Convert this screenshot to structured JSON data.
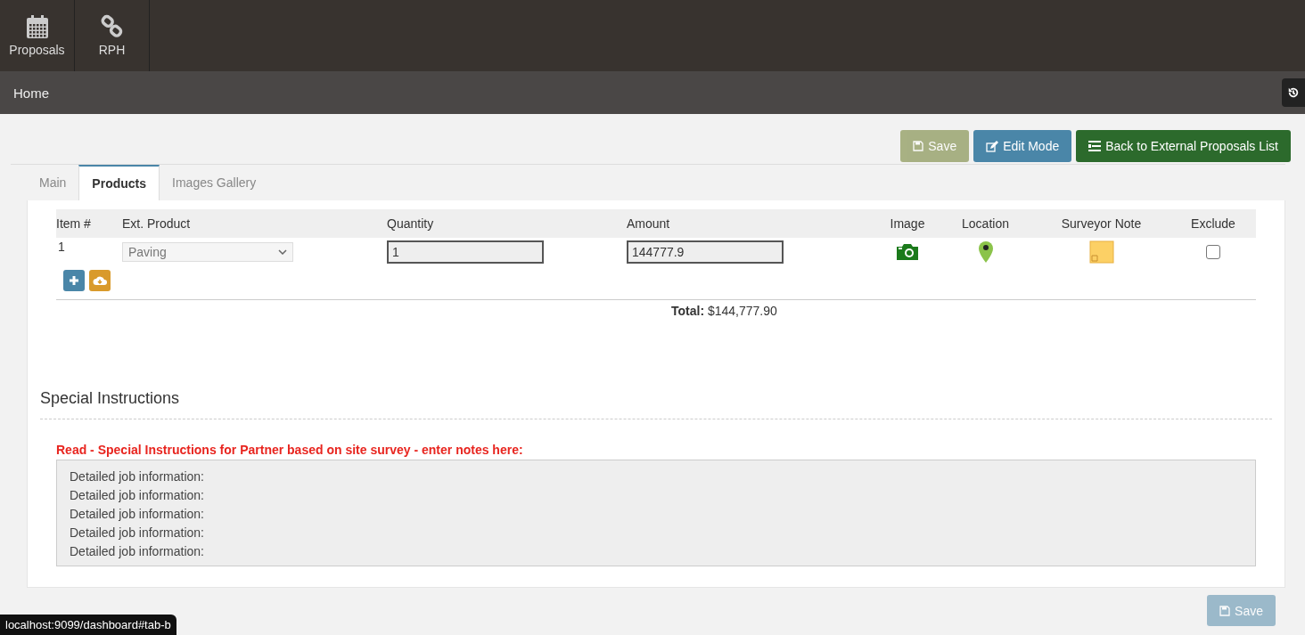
{
  "nav": [
    {
      "label": "Proposals",
      "kind": "calendar"
    },
    {
      "label": "RPH",
      "kind": "link"
    }
  ],
  "breadcrumb": "Home",
  "toolbar": [
    {
      "label": "Save",
      "kind": "save",
      "disabled": true
    },
    {
      "label": "Edit Mode",
      "kind": "edit",
      "disabled": false
    },
    {
      "label": "Back to External Proposals List",
      "kind": "list",
      "disabled": false
    }
  ],
  "tabs": [
    {
      "label": "Main",
      "selected": false
    },
    {
      "label": "Products",
      "selected": true
    },
    {
      "label": "Images Gallery",
      "selected": false
    }
  ],
  "table": {
    "columns": [
      "Item #",
      "Ext. Product",
      "Quantity",
      "Amount",
      "Image",
      "Location",
      "Surveyor Note",
      "Exclude"
    ],
    "rows": [
      {
        "item": "1",
        "product": "Paving",
        "quantity": "1",
        "amount": "144777.9",
        "exclude": false
      }
    ]
  },
  "total_label": "Total:",
  "total_value": "$144,777.90",
  "section_title": "Special Instructions",
  "instructions_label": "Read - Special Instructions for Partner based on site survey - enter notes here:",
  "instructions_lines": [
    "Detailed job information:",
    "Detailed job information:",
    "Detailed job information:",
    "Detailed job information:",
    "Detailed job information:"
  ],
  "bottom_button": {
    "label": "Save",
    "disabled": true
  },
  "status_url": "localhost:9099/dashboard#tab-b"
}
